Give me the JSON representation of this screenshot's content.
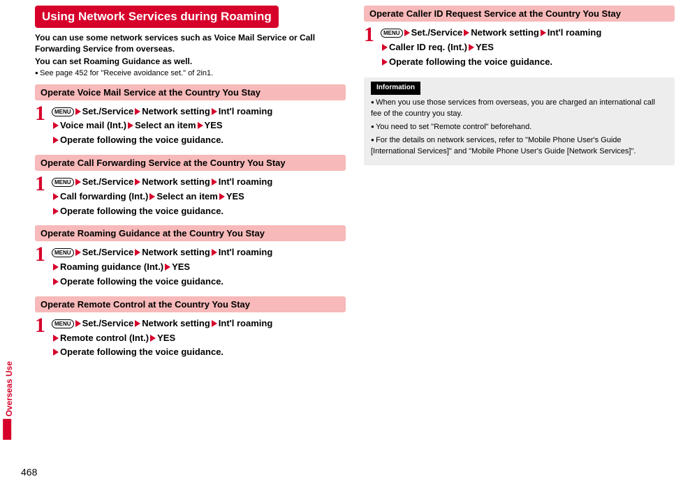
{
  "pageNumber": "468",
  "sideTab": "Overseas Use",
  "menuKey": "MENU",
  "col1": {
    "title": "Using Network Services during Roaming",
    "intro1": "You can use some network services such as Voice Mail Service or Call Forwarding Service from overseas.",
    "intro2": "You can set Roaming Guidance as well.",
    "note": "See page 452 for \"Receive avoidance set.\" of 2in1.",
    "sections": [
      {
        "heading": "Operate Voice Mail Service at the Country You Stay",
        "stepNum": "1",
        "path": [
          "Set./Service",
          "Network setting",
          "Int'l roaming"
        ],
        "path2": [
          "Voice mail (Int.)",
          "Select an item",
          "YES"
        ],
        "final": "Operate following the voice guidance."
      },
      {
        "heading": "Operate Call Forwarding Service at the Country You Stay",
        "stepNum": "1",
        "path": [
          "Set./Service",
          "Network setting",
          "Int'l roaming"
        ],
        "path2": [
          "Call forwarding (Int.)",
          "Select an item",
          "YES"
        ],
        "final": "Operate following the voice guidance."
      },
      {
        "heading": "Operate Roaming Guidance at the Country You Stay",
        "stepNum": "1",
        "path": [
          "Set./Service",
          "Network setting",
          "Int'l roaming"
        ],
        "path2": [
          "Roaming guidance (Int.)",
          "YES"
        ],
        "final": "Operate following the voice guidance."
      },
      {
        "heading": "Operate Remote Control at the Country You Stay",
        "stepNum": "1",
        "path": [
          "Set./Service",
          "Network setting",
          "Int'l roaming"
        ],
        "path2": [
          "Remote control (Int.)",
          "YES"
        ],
        "final": "Operate following the voice guidance."
      }
    ]
  },
  "col2": {
    "section": {
      "heading": "Operate Caller ID Request Service at the Country You Stay",
      "stepNum": "1",
      "path": [
        "Set./Service",
        "Network setting",
        "Int'l roaming"
      ],
      "path2": [
        "Caller ID req. (Int.)",
        "YES"
      ],
      "final": "Operate following the voice guidance."
    },
    "infoLabel": "Information",
    "infoItems": [
      "When you use those services from overseas, you are charged an international call fee of the country you stay.",
      "You need to set \"Remote control\" beforehand.",
      "For the details on network services, refer to \"Mobile Phone User's Guide [International Services]\" and \"Mobile Phone User's Guide [Network Services]\"."
    ]
  }
}
